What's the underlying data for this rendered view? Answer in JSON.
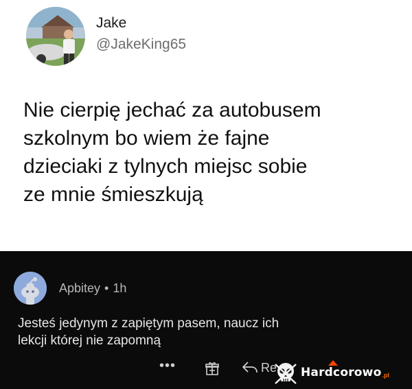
{
  "tweet": {
    "author_name": "Jake",
    "author_handle": "@JakeKing65",
    "text_lines": [
      "Nie cierpię jechać za autobusem",
      "szkolnym bo wiem że fajne",
      "dzieciaki z tylnych miejsc sobie",
      "ze mnie śmieszkują"
    ]
  },
  "comment": {
    "username": "Apbitey",
    "separator": "•",
    "time": "1h",
    "text_lines": [
      "Jesteś jedynym z zapiętym pasem, naucz ich",
      "lekcji której nie zapomną"
    ],
    "actions": {
      "more": "•••",
      "reply_label": "Re"
    }
  },
  "watermark": {
    "text": "Hardcorowo",
    "tld": ".pl"
  },
  "colors": {
    "tweet_bg": "#ffffff",
    "comment_bg": "#0b0b0b",
    "reddit_avatar": "#8ea9dc",
    "watermark_accent": "#ff6a00"
  }
}
